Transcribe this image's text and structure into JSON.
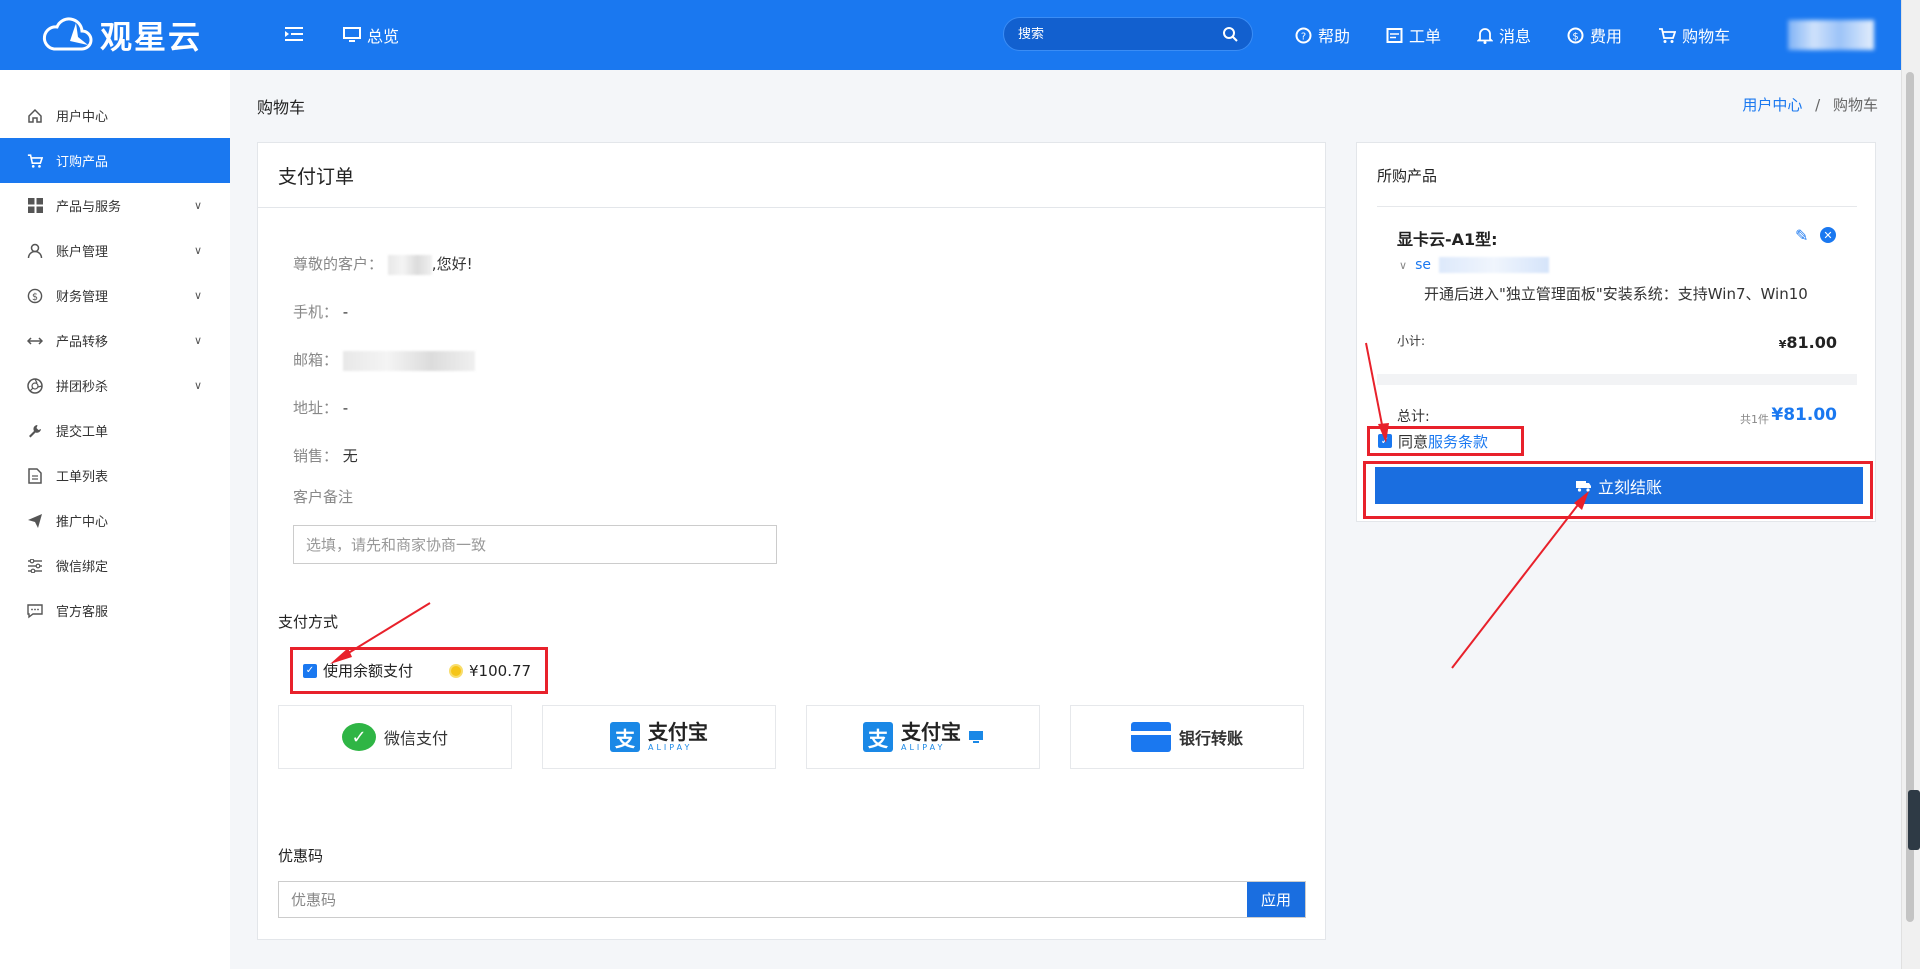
{
  "topbar": {
    "brand": "观星云",
    "overview_label": "总览",
    "search_placeholder": "搜索",
    "nav": [
      {
        "label": "帮助",
        "icon": "help-icon"
      },
      {
        "label": "工单",
        "icon": "ticket-icon"
      },
      {
        "label": "消息",
        "icon": "bell-icon"
      },
      {
        "label": "费用",
        "icon": "dollar-icon"
      },
      {
        "label": "购物车",
        "icon": "cart-icon"
      }
    ]
  },
  "sidebar": {
    "items": [
      {
        "label": "用户中心",
        "icon": "home-icon"
      },
      {
        "label": "订购产品",
        "icon": "cart-icon",
        "active": true
      },
      {
        "label": "产品与服务",
        "icon": "grid-icon"
      },
      {
        "label": "账户管理",
        "icon": "user-icon"
      },
      {
        "label": "财务管理",
        "icon": "dollar-icon"
      },
      {
        "label": "产品转移",
        "icon": "transfer-icon"
      },
      {
        "label": "拼团秒杀",
        "icon": "aperture-icon"
      },
      {
        "label": "提交工单",
        "icon": "wrench-icon"
      },
      {
        "label": "工单列表",
        "icon": "document-icon"
      },
      {
        "label": "推广中心",
        "icon": "send-icon"
      },
      {
        "label": "微信绑定",
        "icon": "sliders-icon"
      },
      {
        "label": "官方客服",
        "icon": "chat-icon"
      }
    ]
  },
  "page": {
    "title": "购物车",
    "breadcrumb_home": "用户中心",
    "breadcrumb_sep": "/",
    "breadcrumb_current": "购物车"
  },
  "order": {
    "heading": "支付订单",
    "greeting_label": "尊敬的客户：",
    "greeting_suffix": ",您好!",
    "phone_label": "手机：",
    "phone_value": "-",
    "email_label": "邮箱：",
    "address_label": "地址：",
    "address_value": "-",
    "sales_label": "销售：",
    "sales_value": "无",
    "note_label": "客户备注",
    "note_placeholder": "选填，请先和商家协商一致",
    "payment_label": "支付方式",
    "balance_label": "使用余额支付",
    "balance_amount": "¥100.77",
    "methods": {
      "wechat": "微信支付",
      "alipay_cn": "支付宝",
      "alipay_en": "ALIPAY",
      "bank": "银行转账"
    },
    "coupon_label": "优惠码",
    "coupon_placeholder": "优惠码",
    "apply_label": "应用"
  },
  "cart": {
    "heading": "所购产品",
    "product_name": "显卡云-A1型:",
    "product_sub": "se",
    "product_desc": "开通后进入\"独立管理面板\"安装系统：支持Win7、Win10",
    "subtotal_label": "小计:",
    "subtotal_currency": "¥",
    "subtotal_value": "81.00",
    "total_label": "总计:",
    "total_count": "共1件",
    "total_value": "¥81.00",
    "agree_label": "同意",
    "terms_label": "服务条款",
    "checkout_label": "立刻结账"
  },
  "colors": {
    "primary": "#1a78f0",
    "highlight": "#e8212b"
  }
}
